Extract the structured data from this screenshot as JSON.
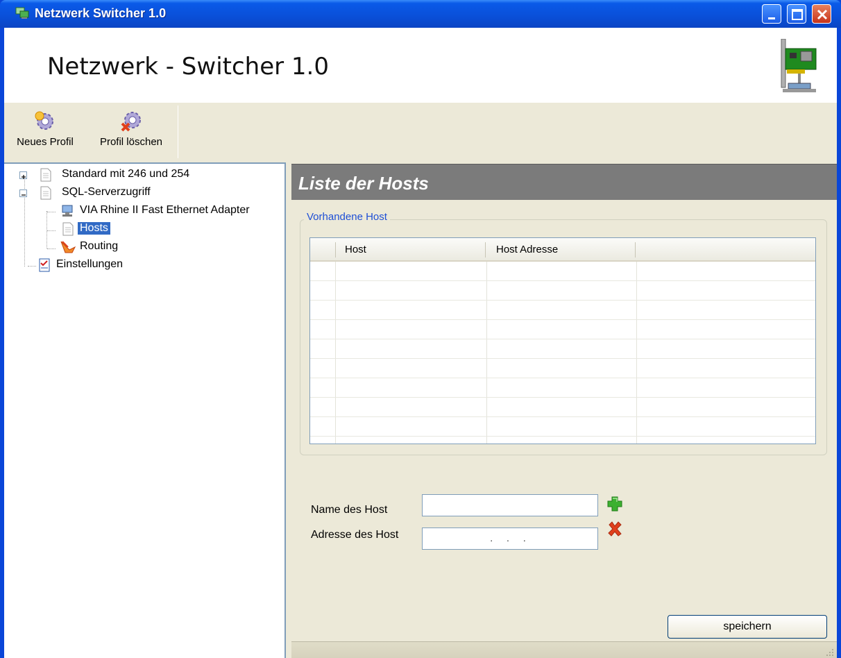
{
  "window": {
    "title": "Netzwerk Switcher 1.0",
    "controls": {
      "minimize_icon": "minimize-icon",
      "maximize_icon": "maximize-icon",
      "close_icon": "close-icon"
    }
  },
  "header": {
    "title": "Netzwerk - Switcher 1.0",
    "icon": "network-card-icon"
  },
  "toolbar": {
    "new_profile": "Neues Profil",
    "delete_profile": "Profil löschen"
  },
  "tree": {
    "items": [
      {
        "label": "Standard mit 246 und 254",
        "icon": "document-icon",
        "expander": "+"
      },
      {
        "label": "SQL-Serverzugriff",
        "icon": "document-icon",
        "expander": "−"
      },
      {
        "label": "VIA Rhine II Fast Ethernet Adapter",
        "icon": "network-adapter-icon"
      },
      {
        "label": "Hosts",
        "icon": "document-icon",
        "selected": true
      },
      {
        "label": "Routing",
        "icon": "routing-icon"
      },
      {
        "label": "Einstellungen",
        "icon": "settings-checklist-icon"
      }
    ]
  },
  "panel": {
    "title": "Liste der Hosts",
    "group_title": "Vorhandene Host",
    "grid": {
      "columns": [
        "Host",
        "Host Adresse"
      ],
      "rows": []
    },
    "name_label": "Name des Host",
    "address_label": "Adresse des Host",
    "name_value": "",
    "address_value": ". . .",
    "save_label": "speichern"
  },
  "colors": {
    "titlebar": "#0a4fd8",
    "section_header": "#7b7b7b",
    "selection": "#316ac5",
    "group_title": "#1e4fd6",
    "add_icon": "#3cb030",
    "delete_icon": "#e0401c"
  }
}
